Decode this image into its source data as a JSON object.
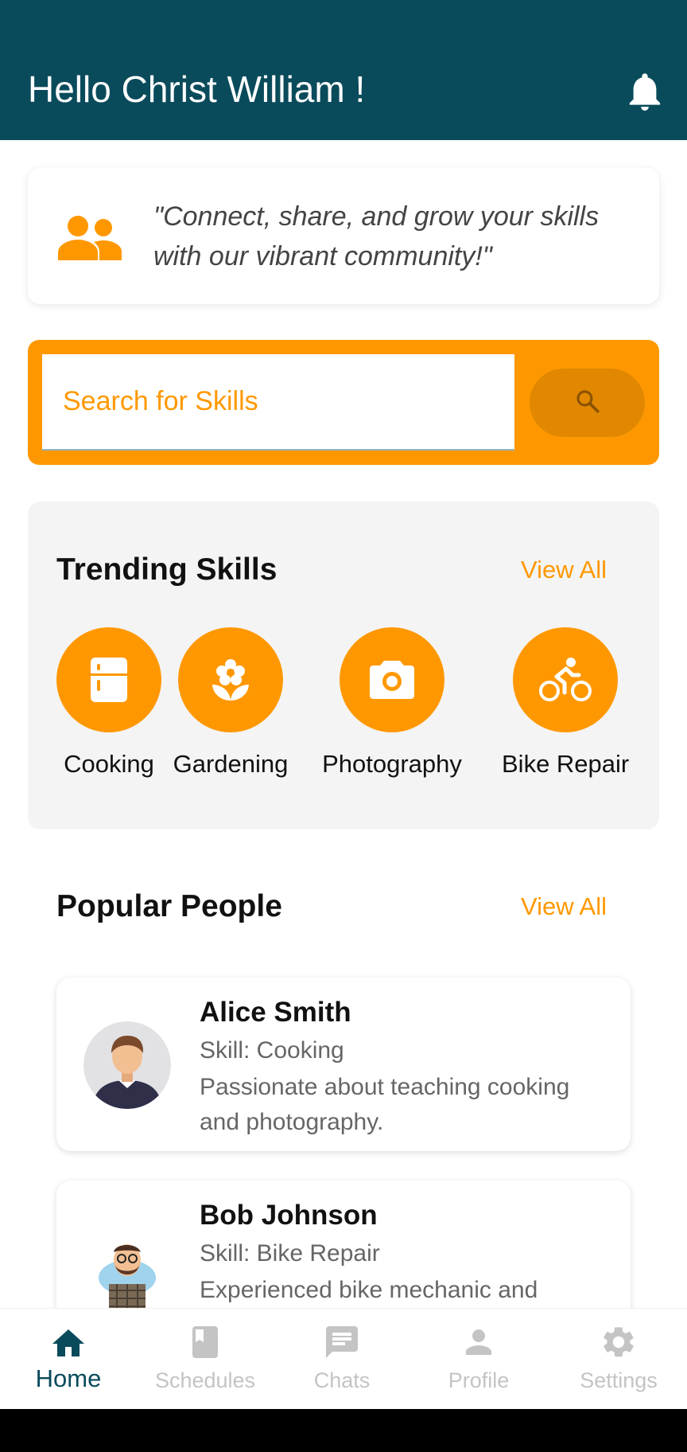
{
  "header": {
    "greeting": "Hello Christ William !",
    "icon": "bell-icon"
  },
  "quote": {
    "text": "\"Connect, share, and grow your skills with our vibrant community!\"",
    "icon": "people-icon"
  },
  "search": {
    "placeholder": "Search for Skills",
    "icon": "search-icon"
  },
  "trending": {
    "title": "Trending Skills",
    "view_all": "View All",
    "skills": [
      {
        "label": "Cooking",
        "icon": "kitchen-icon"
      },
      {
        "label": "Gardening",
        "icon": "flower-icon"
      },
      {
        "label": "Photography",
        "icon": "camera-icon"
      },
      {
        "label": "Bike Repair",
        "icon": "bicycle-icon"
      }
    ]
  },
  "popular": {
    "title": "Popular People",
    "view_all": "View All",
    "people": [
      {
        "name": "Alice Smith",
        "skill": "Skill: Cooking",
        "bio": "Passionate about teaching cooking and photography."
      },
      {
        "name": "Bob Johnson",
        "skill": "Skill: Bike Repair",
        "bio": "Experienced bike mechanic and"
      }
    ]
  },
  "nav": {
    "items": [
      {
        "label": "Home",
        "icon": "home-icon",
        "active": true
      },
      {
        "label": "Schedules",
        "icon": "book-icon",
        "active": false
      },
      {
        "label": "Chats",
        "icon": "chat-icon",
        "active": false
      },
      {
        "label": "Profile",
        "icon": "person-icon",
        "active": false
      },
      {
        "label": "Settings",
        "icon": "gear-icon",
        "active": false
      }
    ]
  },
  "colors": {
    "primary": "#0a4b5b",
    "accent": "#ff9800",
    "inactive": "#c4c4c4"
  }
}
